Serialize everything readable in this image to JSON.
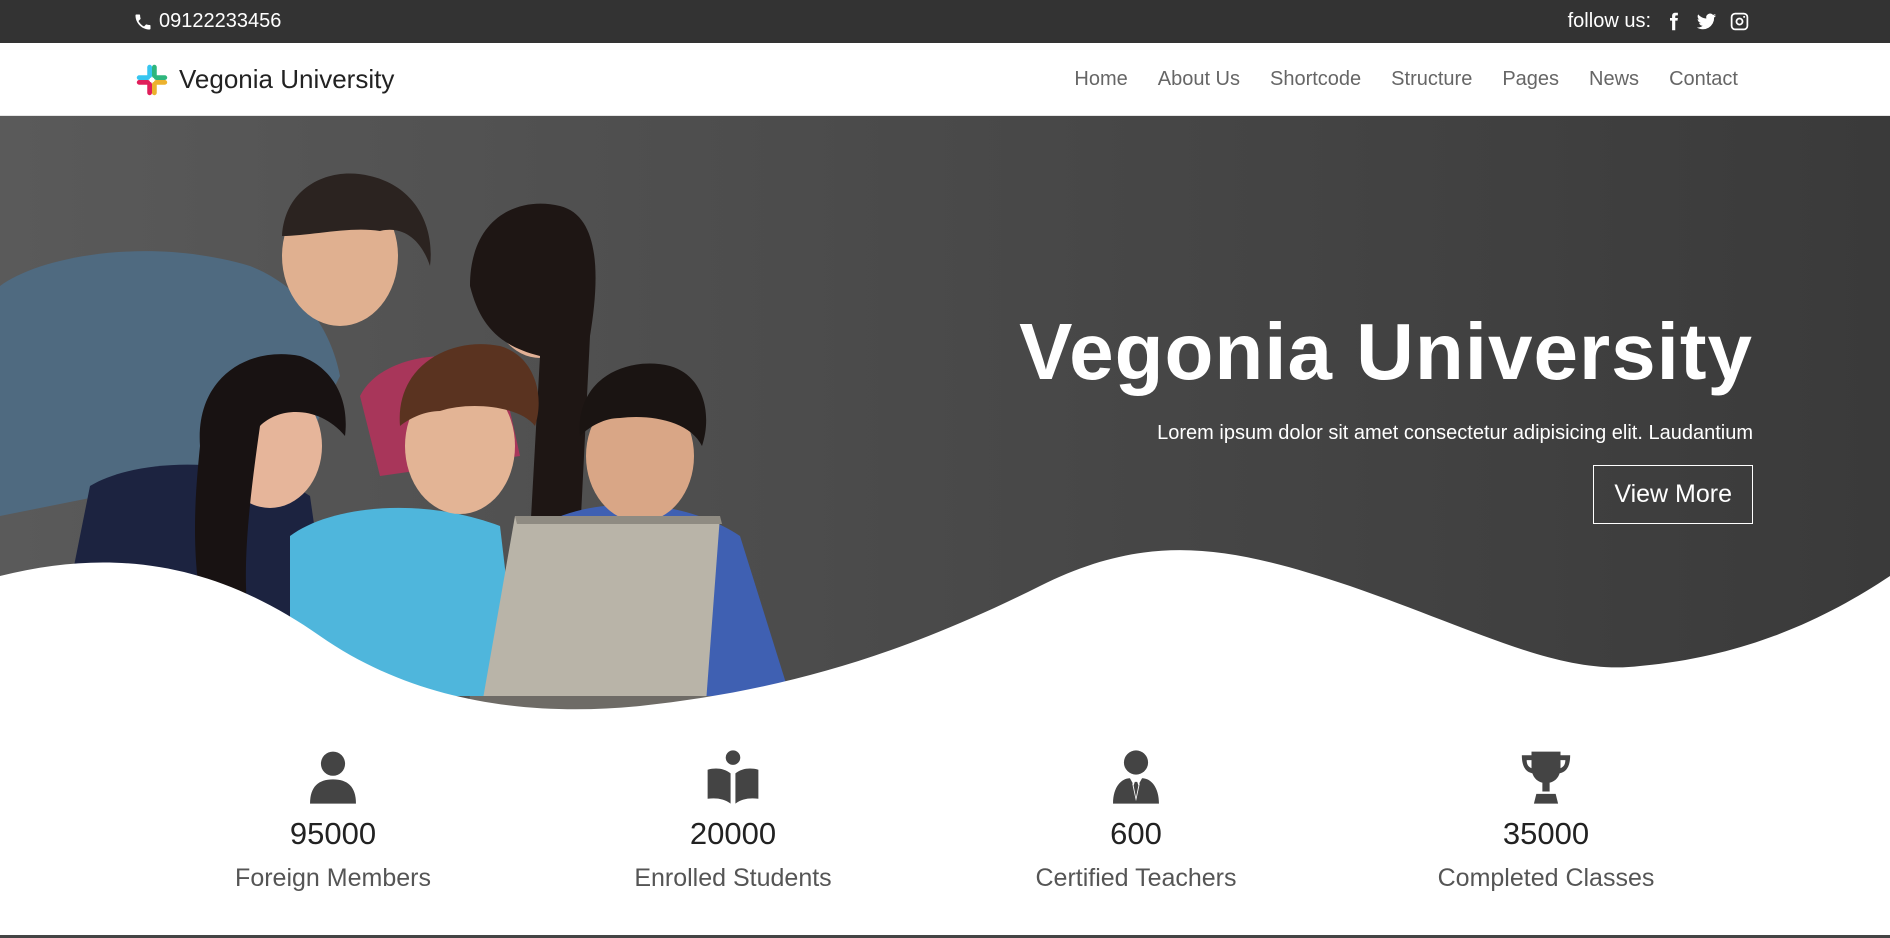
{
  "topbar": {
    "phone": "09122233456",
    "follow_label": "follow us:",
    "social": [
      "facebook-icon",
      "twitter-icon",
      "instagram-icon"
    ]
  },
  "brand": {
    "name": "Vegonia University",
    "logo": "pinwheel-logo"
  },
  "nav": {
    "items": [
      {
        "label": "Home"
      },
      {
        "label": "About Us"
      },
      {
        "label": "Shortcode"
      },
      {
        "label": "Structure"
      },
      {
        "label": "Pages"
      },
      {
        "label": "News"
      },
      {
        "label": "Contact"
      }
    ]
  },
  "hero": {
    "title": "Vegonia University",
    "subtitle": "Lorem ipsum dolor sit amet consectetur adipisicing elit. Laudantium",
    "button": "View More"
  },
  "stats": [
    {
      "icon": "user-icon",
      "value": "95000",
      "label": "Foreign Members"
    },
    {
      "icon": "open-book-icon",
      "value": "20000",
      "label": "Enrolled Students"
    },
    {
      "icon": "teacher-icon",
      "value": "600",
      "label": "Certified Teachers"
    },
    {
      "icon": "trophy-icon",
      "value": "35000",
      "label": "Completed Classes"
    }
  ],
  "colors": {
    "topbar": "#333333",
    "hero_dark": "#3a3a3a",
    "text_muted": "#666666",
    "icon": "#444444"
  }
}
